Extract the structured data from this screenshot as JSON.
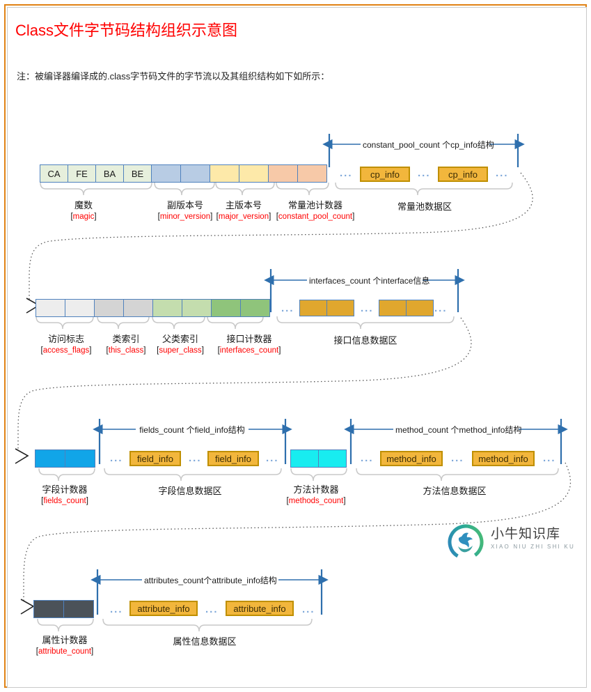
{
  "page": {
    "title": "Class文件字节码结构组织示意图",
    "note": "注：被编译器编译成的.class字节码文件的字节流以及其组织结构如下如所示：",
    "border_color": "#e08214",
    "title_color": "#ff0000"
  },
  "colors": {
    "cell_border": "#4f81bd",
    "magic_fill": "#e6efdc",
    "minor_fill": "#b8cce4",
    "major_fill": "#fde9a9",
    "cp_count_fill": "#f7c9a8",
    "access_flags_fill": "#ededed",
    "this_class_fill": "#d4d4d4",
    "super_class_fill": "#c4ddae",
    "interfaces_count_fill": "#8fc47b",
    "fields_count_fill": "#11a5e8",
    "methods_count_fill": "#18ecf0",
    "attribute_count_fill": "#4b5259",
    "info_box_fill": "#f2b63c",
    "info_box_border": "#bf8f00",
    "interface_block_fill": "#e0a72e",
    "arrow_blue": "#2e6fad",
    "brace_gray": "#c8c8c8",
    "dots_blue": "#7da7d9",
    "en_label_red": "#ff0000"
  },
  "row1": {
    "cells": [
      "CA",
      "FE",
      "BA",
      "BE"
    ],
    "dim_label": "constant_pool_count 个cp_info结构",
    "info_boxes": [
      "cp_info",
      "cp_info"
    ],
    "dots": [
      "...",
      "...",
      "..."
    ],
    "captions": [
      {
        "cn": "魔数",
        "en": "magic"
      },
      {
        "cn": "副版本号",
        "en": "minor_version"
      },
      {
        "cn": "主版本号",
        "en": "major_version"
      },
      {
        "cn": "常量池计数器",
        "en": "constant_pool_count"
      }
    ],
    "area_label": "常量池数据区"
  },
  "row2": {
    "dim_label": "interfaces_count 个interface信息",
    "dots": [
      "...",
      "...",
      "..."
    ],
    "captions": [
      {
        "cn": "访问标志",
        "en": "access_flags"
      },
      {
        "cn": "类索引",
        "en": "this_class"
      },
      {
        "cn": "父类索引",
        "en": "super_class"
      },
      {
        "cn": "接口计数器",
        "en": "interfaces_count"
      }
    ],
    "area_label": "接口信息数据区"
  },
  "row3": {
    "fields_dim_label": "fields_count 个field_info结构",
    "fields_info_boxes": [
      "field_info",
      "field_info"
    ],
    "fields_dots": [
      "...",
      "...",
      "..."
    ],
    "methods_dim_label": "method_count 个method_info结构",
    "methods_info_boxes": [
      "method_info",
      "method_info"
    ],
    "methods_dots": [
      "...",
      "...",
      "..."
    ],
    "captions": [
      {
        "cn": "字段计数器",
        "en": "fields_count"
      },
      {
        "cn": "方法计数器",
        "en": "methods_count"
      }
    ],
    "fields_area_label": "字段信息数据区",
    "methods_area_label": "方法信息数据区"
  },
  "row4": {
    "dim_label": "attributes_count个attribute_info结构",
    "info_boxes": [
      "attribute_info",
      "attribute_info"
    ],
    "dots": [
      "...",
      "...",
      "..."
    ],
    "captions": [
      {
        "cn": "属性计数器",
        "en": "attribute_count"
      }
    ],
    "area_label": "属性信息数据区"
  },
  "logo": {
    "name_cn": "小牛知识库",
    "name_en": "XIAO NIU ZHI SHI KU"
  }
}
